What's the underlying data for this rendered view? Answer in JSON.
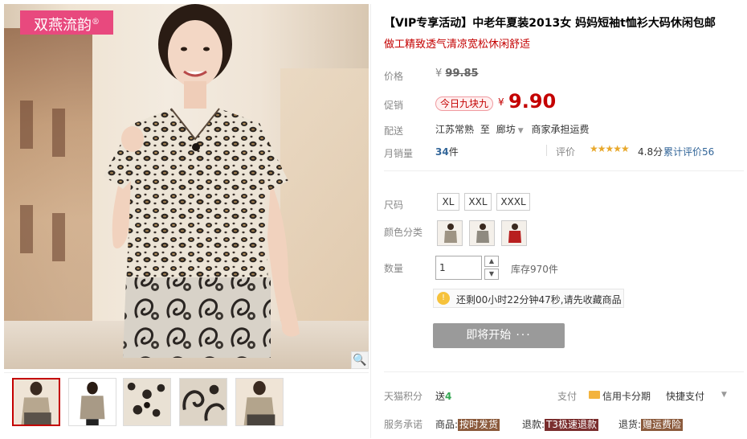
{
  "gallery": {
    "brand": "双燕流韵",
    "brand_mark": "®",
    "zoom_icon": "magnifier-icon",
    "thumbnails": [
      "thumb-1",
      "thumb-2",
      "thumb-3",
      "thumb-4",
      "thumb-5"
    ]
  },
  "product": {
    "title": "【VIP专享活动】中老年夏装2013女 妈妈短袖t恤衫大码休闲包邮",
    "subtitle": "做工精致透气清凉宽松休闲舒适"
  },
  "price": {
    "label": "价格",
    "currency": "¥",
    "original": "99.85"
  },
  "promo": {
    "label": "促销",
    "badge": "今日九块九",
    "currency": "¥",
    "price": "9.90"
  },
  "shipping": {
    "label": "配送",
    "from": "江苏常熟",
    "to_word": "至",
    "to": "廊坊",
    "note": "商家承担运费"
  },
  "sales": {
    "label": "月销量",
    "count": "34",
    "unit": "件",
    "rating_label": "评价",
    "stars": "★★★★★",
    "score": "4.8分",
    "review_count": "累计评价56"
  },
  "options": {
    "size_label": "尺码",
    "sizes": [
      "XL",
      "XXL",
      "XXXL"
    ],
    "color_label": "颜色分类",
    "colors": [
      "leopard-gray",
      "leopard-gray-2",
      "red"
    ]
  },
  "quantity": {
    "label": "数量",
    "value": "1",
    "stock": "库存970件"
  },
  "countdown": {
    "icon": "lightbulb-icon",
    "text": "还剩00小时22分钟47秒,请先收藏商品"
  },
  "action": {
    "start_label": "即将开始",
    "dots": "···"
  },
  "footer": {
    "points_label": "天猫积分",
    "points_prefix": "送",
    "points_value": "4",
    "pay_label": "支付",
    "pay_card": "信用卡分期",
    "pay_quick": "快捷支付",
    "service_label": "服务承诺",
    "svc1_prefix": "商品:",
    "svc1_tag": "按时发货",
    "svc2_prefix": "退款:",
    "svc2_tag": "T3极速退款",
    "svc3_prefix": "退货:",
    "svc3_tag": "赠运费险"
  },
  "colors": {
    "accent_red": "#c40000",
    "brand_pink": "#e8497e",
    "link_blue": "#336699",
    "star_orange": "#e8a82b",
    "disabled_button": "#9a9a9a",
    "tag_brown": "#8b5a3c"
  }
}
